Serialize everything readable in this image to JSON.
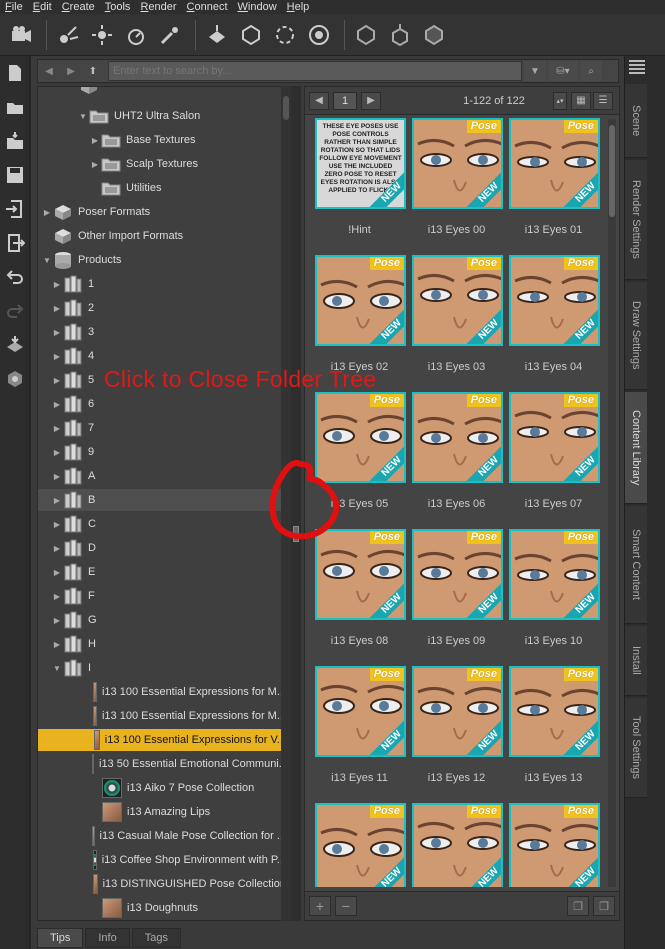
{
  "menubar": {
    "items": [
      {
        "label": "File",
        "u": "F",
        "rest": "ile"
      },
      {
        "label": "Edit",
        "u": "E",
        "rest": "dit"
      },
      {
        "label": "Create",
        "u": "C",
        "rest": "reate"
      },
      {
        "label": "Tools",
        "u": "T",
        "rest": "ools"
      },
      {
        "label": "Render",
        "u": "R",
        "rest": "ender"
      },
      {
        "label": "Connect",
        "u": "C",
        "rest": "onnect"
      },
      {
        "label": "Window",
        "u": "W",
        "rest": "indow"
      },
      {
        "label": "Help",
        "u": "H",
        "rest": "elp"
      }
    ]
  },
  "search": {
    "placeholder": "Enter text to search by..."
  },
  "tree": {
    "items": [
      {
        "label": "UHT2 Ultra Salon",
        "indent": 3,
        "arrow": "down",
        "icon": "folder"
      },
      {
        "label": "Base Textures",
        "indent": 4,
        "arrow": "right",
        "icon": "folder"
      },
      {
        "label": "Scalp Textures",
        "indent": 4,
        "arrow": "right",
        "icon": "folder"
      },
      {
        "label": "Utilities",
        "indent": 4,
        "arrow": "",
        "icon": "folder"
      },
      {
        "label": "Poser Formats",
        "indent": 1,
        "arrow": "right",
        "icon": "box"
      },
      {
        "label": "Other Import Formats",
        "indent": 1,
        "arrow": "",
        "icon": "box"
      },
      {
        "label": "Products",
        "indent": 1,
        "arrow": "down",
        "icon": "db"
      },
      {
        "label": "1",
        "indent": 2,
        "arrow": "right",
        "icon": "books"
      },
      {
        "label": "2",
        "indent": 2,
        "arrow": "right",
        "icon": "books"
      },
      {
        "label": "3",
        "indent": 2,
        "arrow": "right",
        "icon": "books"
      },
      {
        "label": "4",
        "indent": 2,
        "arrow": "right",
        "icon": "books"
      },
      {
        "label": "5",
        "indent": 2,
        "arrow": "right",
        "icon": "books"
      },
      {
        "label": "6",
        "indent": 2,
        "arrow": "right",
        "icon": "books"
      },
      {
        "label": "7",
        "indent": 2,
        "arrow": "right",
        "icon": "books"
      },
      {
        "label": "9",
        "indent": 2,
        "arrow": "right",
        "icon": "books"
      },
      {
        "label": "A",
        "indent": 2,
        "arrow": "right",
        "icon": "books"
      },
      {
        "label": "B",
        "indent": 2,
        "arrow": "right",
        "icon": "books",
        "hl": true
      },
      {
        "label": "C",
        "indent": 2,
        "arrow": "right",
        "icon": "books"
      },
      {
        "label": "D",
        "indent": 2,
        "arrow": "right",
        "icon": "books"
      },
      {
        "label": "E",
        "indent": 2,
        "arrow": "right",
        "icon": "books"
      },
      {
        "label": "F",
        "indent": 2,
        "arrow": "right",
        "icon": "books"
      },
      {
        "label": "G",
        "indent": 2,
        "arrow": "right",
        "icon": "books"
      },
      {
        "label": "H",
        "indent": 2,
        "arrow": "right",
        "icon": "books"
      },
      {
        "label": "I",
        "indent": 2,
        "arrow": "down",
        "icon": "books"
      },
      {
        "label": "i13 100 Essential Expressions for M...",
        "indent": 3,
        "arrow": "",
        "icon": "thumb"
      },
      {
        "label": "i13 100 Essential Expressions for M...",
        "indent": 3,
        "arrow": "",
        "icon": "thumb"
      },
      {
        "label": "i13 100 Essential Expressions for V...",
        "indent": 3,
        "arrow": "",
        "icon": "thumb",
        "selected": true
      },
      {
        "label": "i13 50 Essential Emotional Communi...",
        "indent": 3,
        "arrow": "",
        "icon": "thumb"
      },
      {
        "label": "i13 Aiko 7 Pose Collection",
        "indent": 3,
        "arrow": "",
        "icon": "circ"
      },
      {
        "label": "i13 Amazing Lips",
        "indent": 3,
        "arrow": "",
        "icon": "thumb"
      },
      {
        "label": "i13 Casual Male Pose Collection for ...",
        "indent": 3,
        "arrow": "",
        "icon": "thumb"
      },
      {
        "label": "i13 Coffee Shop Environment with P...",
        "indent": 3,
        "arrow": "",
        "icon": "circ"
      },
      {
        "label": "i13 DISTINGUISHED Pose Collection",
        "indent": 3,
        "arrow": "",
        "icon": "thumb"
      },
      {
        "label": "i13 Doughnuts",
        "indent": 3,
        "arrow": "",
        "icon": "thumb"
      }
    ]
  },
  "grid": {
    "page": "1",
    "count": "1-122 of 122",
    "pose_label": "Pose",
    "new_label": "NEW",
    "hint_text": "THESE EYE POSES USE POSE CONTROLS RATHER THAN SIMPLE ROTATION SO THAT LIDS FOLLOW EYE MOVEMENT USE THE INCLUDED ZERO POSE TO RESET EYES ROTATION IS ALSO APPLIED TO FLICKS",
    "items": [
      {
        "label": "!Hint",
        "hint": true
      },
      {
        "label": "i13 Eyes 00"
      },
      {
        "label": "i13 Eyes 01"
      },
      {
        "label": "i13 Eyes 02"
      },
      {
        "label": "i13 Eyes 03"
      },
      {
        "label": "i13 Eyes 04"
      },
      {
        "label": "i13 Eyes 05"
      },
      {
        "label": "i13 Eyes 06"
      },
      {
        "label": "i13 Eyes 07"
      },
      {
        "label": "i13 Eyes 08"
      },
      {
        "label": "i13 Eyes 09"
      },
      {
        "label": "i13 Eyes 10"
      },
      {
        "label": "i13 Eyes 11"
      },
      {
        "label": "i13 Eyes 12"
      },
      {
        "label": "i13 Eyes 13"
      },
      {
        "label": ""
      },
      {
        "label": ""
      },
      {
        "label": ""
      }
    ]
  },
  "bottom_tabs": [
    {
      "label": "Tips",
      "active": true
    },
    {
      "label": "Info",
      "active": false
    },
    {
      "label": "Tags",
      "active": false
    }
  ],
  "right_tabs": [
    {
      "label": "Scene",
      "active": false
    },
    {
      "label": "Render Settings",
      "active": false
    },
    {
      "label": "Draw Settings",
      "active": false
    },
    {
      "label": "Content Library",
      "active": true
    },
    {
      "label": "Smart Content",
      "active": false
    },
    {
      "label": "Install",
      "active": false
    },
    {
      "label": "Tool Settings",
      "active": false
    }
  ],
  "annotation": {
    "text": "Click to Close Folder Tree",
    "color": "#e01818"
  },
  "colors": {
    "selected": "#e8b31e",
    "thumb_border": "#19c0c4",
    "pose_tag": "#f0c21c"
  }
}
